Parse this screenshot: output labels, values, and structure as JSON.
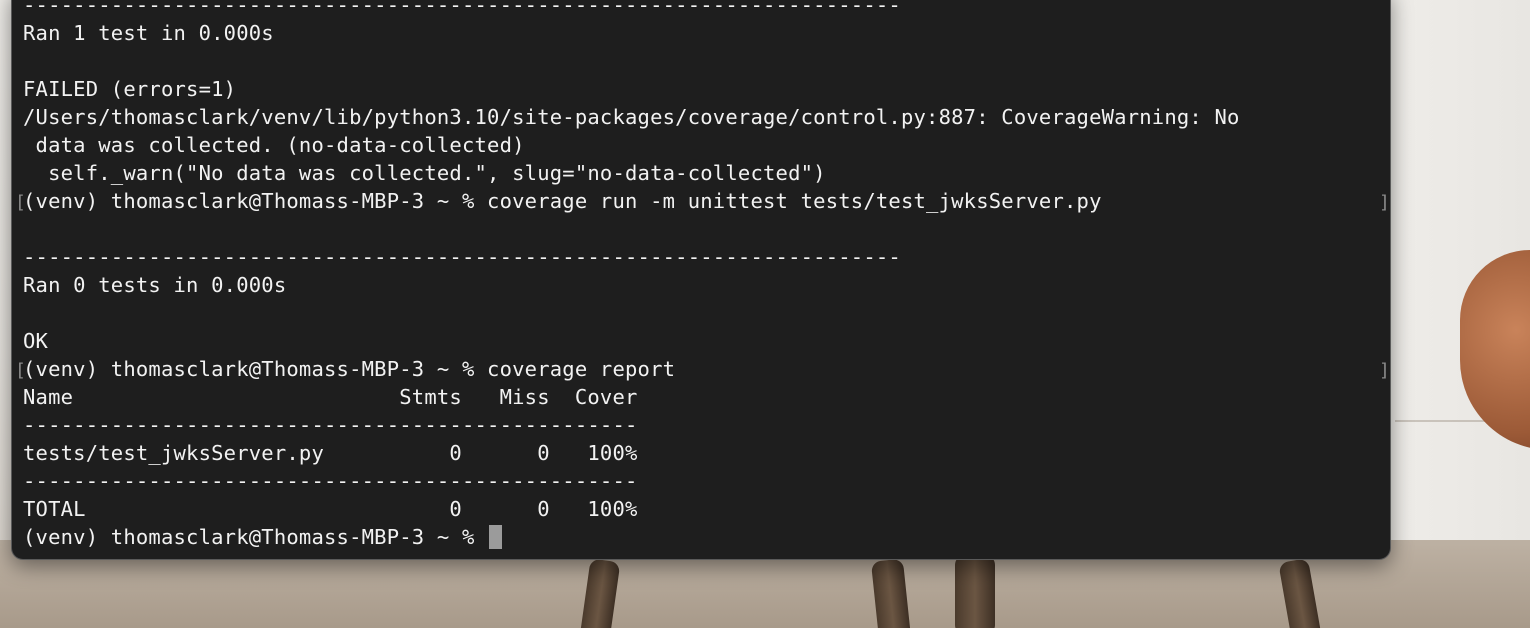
{
  "terminal": {
    "lines": [
      "----------------------------------------------------------------------",
      "Ran 1 test in 0.000s",
      "",
      "FAILED (errors=1)",
      "/Users/thomasclark/venv/lib/python3.10/site-packages/coverage/control.py:887: CoverageWarning: No",
      " data was collected. (no-data-collected)",
      "  self._warn(\"No data was collected.\", slug=\"no-data-collected\")",
      "(venv) thomasclark@Thomass-MBP-3 ~ % coverage run -m unittest tests/test_jwksServer.py",
      "",
      "----------------------------------------------------------------------",
      "Ran 0 tests in 0.000s",
      "",
      "OK",
      "(venv) thomasclark@Thomass-MBP-3 ~ % coverage report",
      "Name                          Stmts   Miss  Cover",
      "-------------------------------------------------",
      "tests/test_jwksServer.py          0      0   100%",
      "-------------------------------------------------",
      "TOTAL                             0      0   100%",
      "(venv) thomasclark@Thomass-MBP-3 ~ % "
    ],
    "mark_left": "[",
    "mark_right": "]"
  },
  "colors": {
    "terminal_bg": "#1e1e1e",
    "text": "#f2f2f2",
    "cursor": "#9b9b9b"
  }
}
